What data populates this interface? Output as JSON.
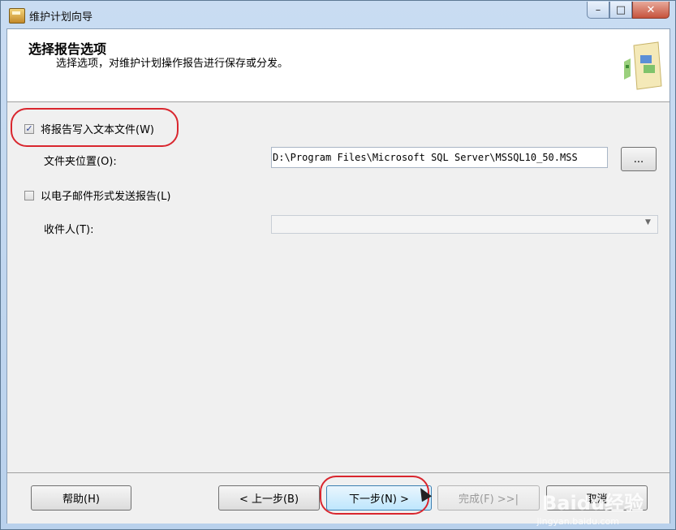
{
  "window": {
    "title": "维护计划向导"
  },
  "header": {
    "title": "选择报告选项",
    "subtitle": "选择选项，对维护计划操作报告进行保存或分发。"
  },
  "options": {
    "write_to_file": {
      "label": "将报告写入文本文件(W)",
      "checked": true
    },
    "folder_label": "文件夹位置(O):",
    "folder_value": "D:\\Program Files\\Microsoft SQL Server\\MSSQL10_50.MSS",
    "browse_label": "...",
    "email_report": {
      "label": "以电子邮件形式发送报告(L)",
      "checked": false
    },
    "recipient_label": "收件人(T):",
    "recipient_value": ""
  },
  "footer": {
    "help": "帮助(H)",
    "back": "< 上一步(B)",
    "next": "下一步(N) >",
    "finish": "完成(F) >>|",
    "cancel": "取消"
  },
  "watermark": {
    "brand": "Baidu经验",
    "url": "jingyan.baidu.com"
  }
}
